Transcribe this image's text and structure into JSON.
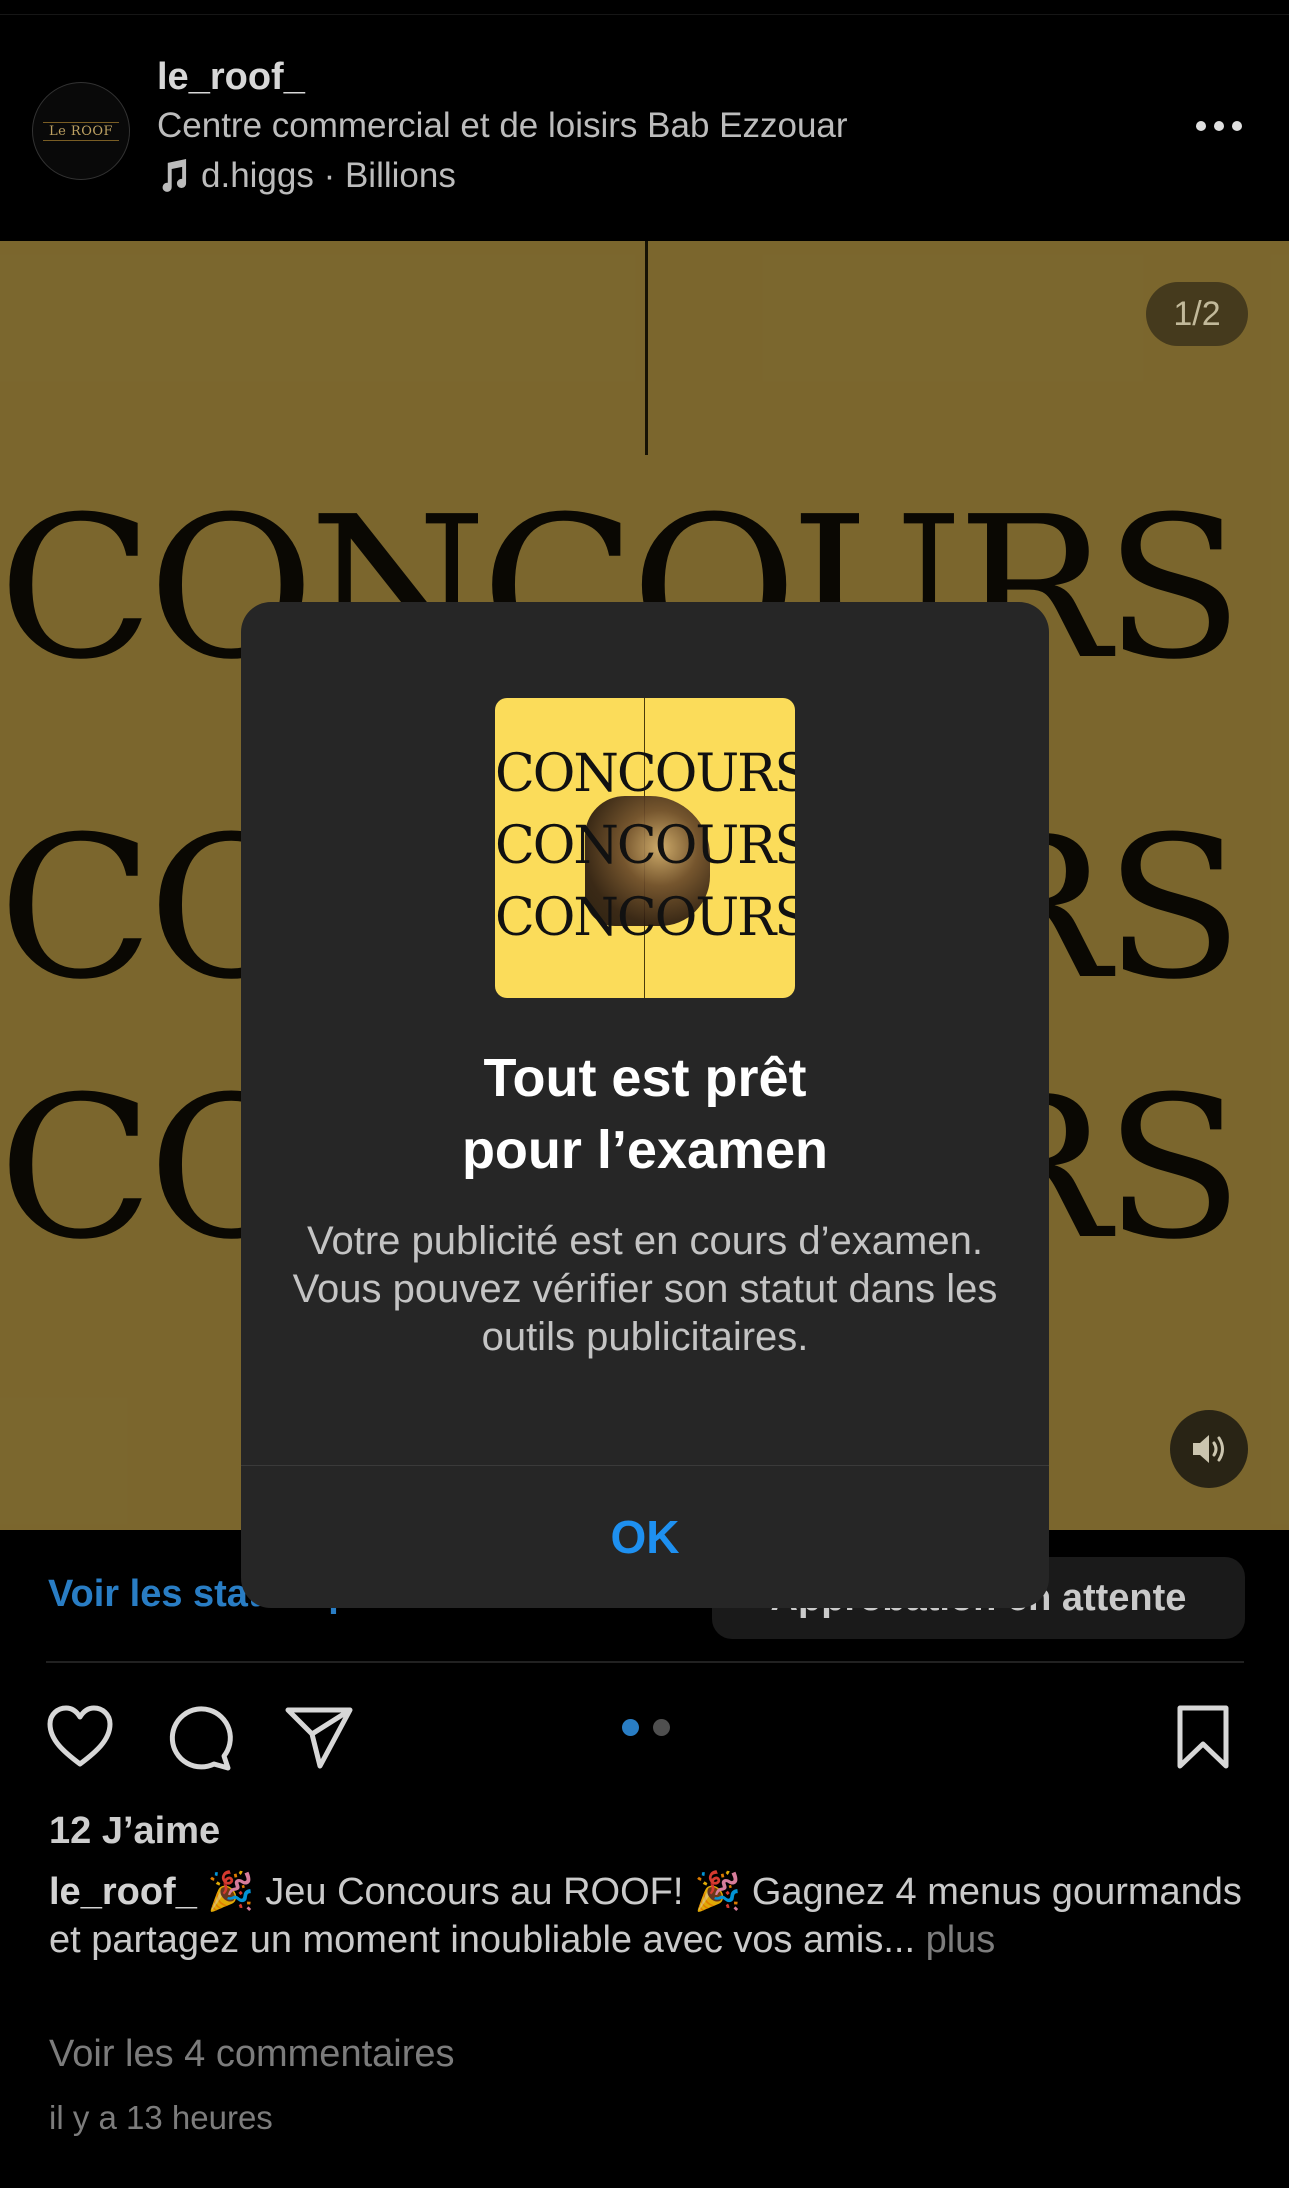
{
  "post": {
    "username": "le_roof_",
    "location": "Centre commercial et de loisirs Bab Ezzouar",
    "music": "d.higgs · Billions",
    "avatar_logo_text": "Le ROOF",
    "media_counter": "1/2",
    "media_word": "CONCOURS",
    "stats_link": "Voir les statistiques",
    "status_badge": "Approbation en attente",
    "likes": "12 J’aime",
    "caption_user": "le_roof_",
    "caption_text": " 🎉 Jeu Concours au ROOF! 🎉 Gagnez 4 menus gourmands et partagez un moment inoubliable avec vos amis... ",
    "caption_more": "plus",
    "comments_link": "Voir les 4 commentaires",
    "timestamp": "il y a 13 heures",
    "carousel": {
      "total": 2,
      "active": 1
    }
  },
  "icons": {
    "music": "music-note-icon",
    "more": "more-options-icon",
    "mute": "speaker-icon",
    "like": "heart-icon",
    "comment": "comment-icon",
    "share": "send-icon",
    "save": "bookmark-icon"
  },
  "colors": {
    "media_bg": "#8c7534",
    "link_blue": "#2f8fe0",
    "modal_bg": "#262626",
    "ok_blue": "#1e90f0",
    "thumb_bg": "#fbdc5a"
  },
  "modal": {
    "thumb_word": "CONCOURS",
    "title_line1": "Tout est prêt",
    "title_line2": "pour l’examen",
    "body": "Votre publicité est en cours d’examen. Vous pouvez vérifier son statut dans les outils publicitaires.",
    "ok_label": "OK"
  }
}
